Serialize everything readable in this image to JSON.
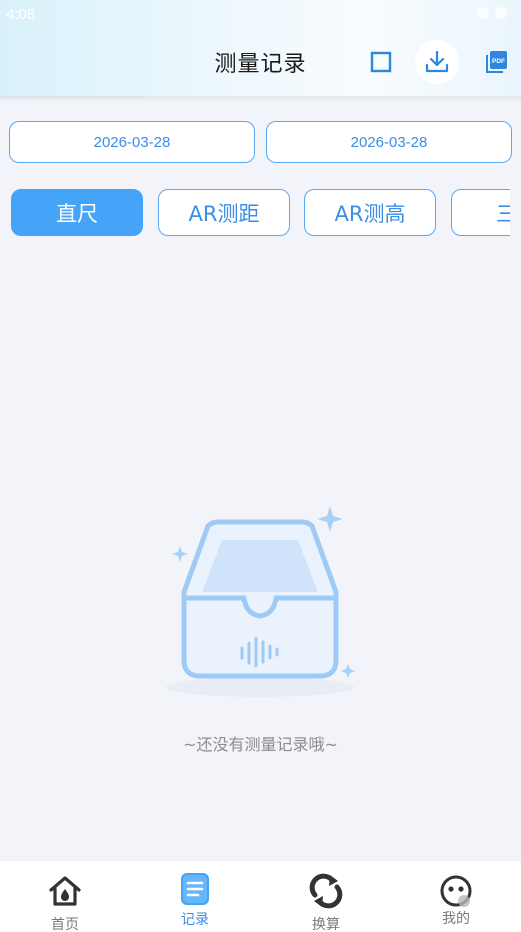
{
  "status_bar": {
    "time": "4:08"
  },
  "header": {
    "title": "测量记录",
    "select_icon": "square-outline-icon",
    "download_icon": "download-icon",
    "pdf_icon": "pdf-file-icon",
    "pdf_badge": "PDF"
  },
  "filters": {
    "start_date": "2026-03-28",
    "end_date": "2026-03-28"
  },
  "tabs": [
    {
      "label": "直尺",
      "active": true
    },
    {
      "label": "AR测距",
      "active": false
    },
    {
      "label": "AR测高",
      "active": false
    },
    {
      "label": "三角",
      "active": false
    }
  ],
  "empty_state": {
    "icon": "empty-inbox-icon",
    "message": "~还没有测量记录哦~"
  },
  "bottom_nav": [
    {
      "label": "首页",
      "icon": "home-icon",
      "active": false
    },
    {
      "label": "记录",
      "icon": "records-icon",
      "active": true
    },
    {
      "label": "换算",
      "icon": "convert-icon",
      "active": false
    },
    {
      "label": "我的",
      "icon": "profile-icon",
      "active": false
    }
  ],
  "colors": {
    "accent": "#44a4f8",
    "accent_text": "#3a8ee6",
    "background": "#f2f4f9",
    "muted_text": "#8c8c8c"
  }
}
